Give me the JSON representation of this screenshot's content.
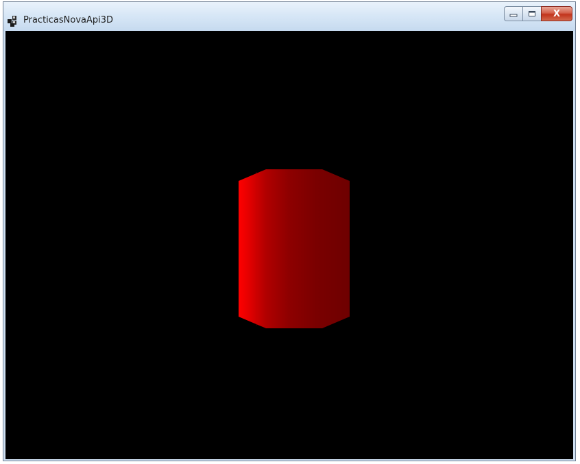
{
  "window": {
    "title": "PracticasNovaApi3D",
    "app_icon": "app-icon",
    "controls": {
      "minimize_icon": "minimize-icon",
      "maximize_icon": "maximize-icon",
      "close_label": "X"
    }
  },
  "viewport": {
    "background": "#000000",
    "object": {
      "shape": "cylinder",
      "color_light": "#ff0000",
      "color_mid": "#b00000",
      "color_dark": "#6e0000"
    }
  }
}
